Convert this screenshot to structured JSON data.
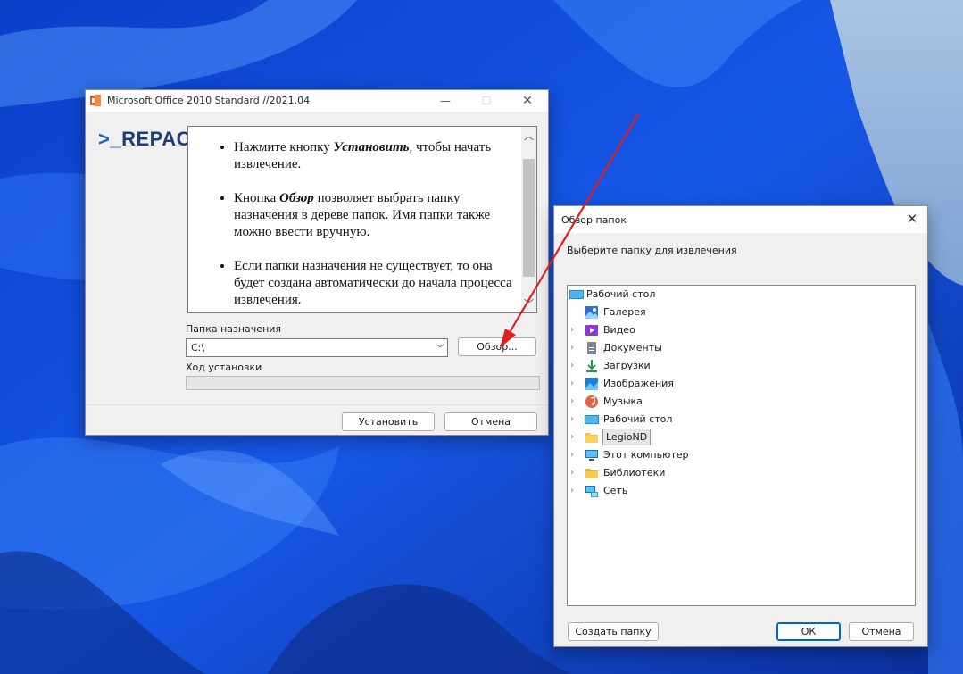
{
  "installer": {
    "title": "Microsoft Office 2010 Standard //2021.04",
    "logo_prompt": ">_",
    "logo_text": "REPAC",
    "info": [
      {
        "pre": "Нажмите кнопку ",
        "bold": "Установить",
        "post": ", чтобы начать извлечение."
      },
      {
        "pre": "Кнопка ",
        "bold": "Обзор",
        "post": " позволяет выбрать папку назначения в дереве папок. Имя папки также можно ввести вручную."
      },
      {
        "pre": "Если папки назначения не существует, то она будет создана автоматически до начала процесса извлечения.",
        "bold": "",
        "post": ""
      }
    ],
    "dest_label": "Папка назначения",
    "dest_value": "C:\\",
    "browse_label": "Обзор...",
    "progress_label": "Ход установки",
    "progress": 0,
    "install_label": "Установить",
    "cancel_label": "Отмена"
  },
  "browse": {
    "title": "Обзор папок",
    "prompt": "Выберите папку для извлечения",
    "tree": {
      "root": "Рабочий стол",
      "items": [
        {
          "label": "Галерея",
          "icon": "gallery-icon",
          "expandable": false
        },
        {
          "label": "Видео",
          "icon": "video-icon",
          "expandable": true
        },
        {
          "label": "Документы",
          "icon": "documents-icon",
          "expandable": true
        },
        {
          "label": "Загрузки",
          "icon": "downloads-icon",
          "expandable": true
        },
        {
          "label": "Изображения",
          "icon": "pictures-icon",
          "expandable": true
        },
        {
          "label": "Музыка",
          "icon": "music-icon",
          "expandable": true
        },
        {
          "label": "Рабочий стол",
          "icon": "desktop-icon",
          "expandable": true
        },
        {
          "label": "LegioND",
          "icon": "folder-icon",
          "expandable": true,
          "selected": true
        },
        {
          "label": "Этот компьютер",
          "icon": "computer-icon",
          "expandable": true
        },
        {
          "label": "Библиотеки",
          "icon": "libraries-icon",
          "expandable": true
        },
        {
          "label": "Сеть",
          "icon": "network-icon",
          "expandable": true
        }
      ]
    },
    "new_folder_label": "Создать папку",
    "ok_label": "ОК",
    "cancel_label": "Отмена"
  },
  "colors": {
    "accent": "#0067c0",
    "annotation_arrow": "#e02020",
    "folder": "#f5c542"
  }
}
